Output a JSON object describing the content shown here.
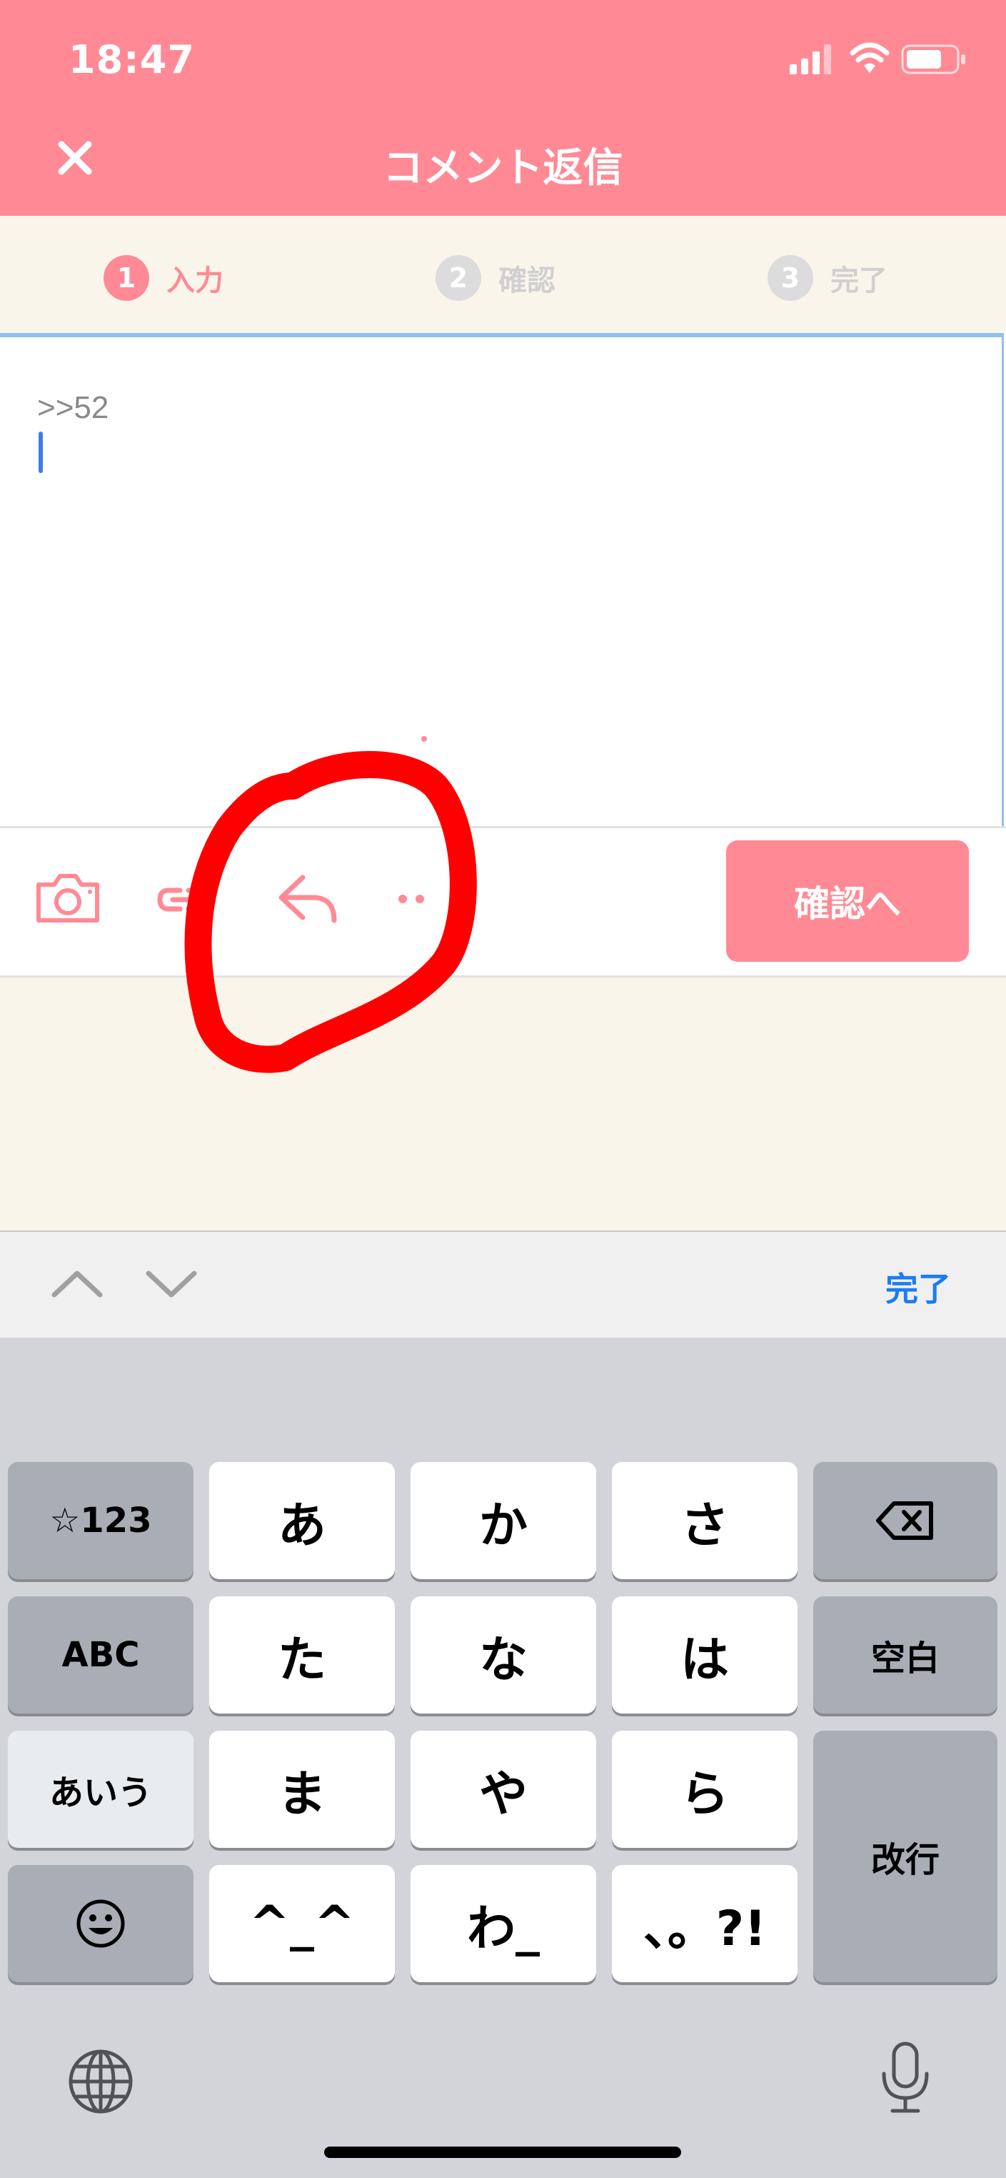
{
  "status_bar": {
    "time": "18:47"
  },
  "header": {
    "title": "コメント返信"
  },
  "steps": [
    {
      "number": "1",
      "label": "入力",
      "active": true
    },
    {
      "number": "2",
      "label": "確認",
      "active": false
    },
    {
      "number": "3",
      "label": "完了",
      "active": false
    }
  ],
  "editor": {
    "text": ">>52"
  },
  "toolbar": {
    "confirm_label": "確認へ"
  },
  "accessory": {
    "done_label": "完了"
  },
  "keyboard": {
    "row1": [
      "☆123",
      "あ",
      "か",
      "さ"
    ],
    "row2": [
      "ABC",
      "た",
      "な",
      "は",
      "空白"
    ],
    "row3": [
      "あいう",
      "ま",
      "や",
      "ら"
    ],
    "row4": [
      "^_^",
      "わ_",
      "、。?!"
    ],
    "return_label": "改行"
  },
  "colors": {
    "brand": "#ff8a95",
    "cream": "#faf5ea",
    "link_blue": "#1a7cf5",
    "annotation": "#ff0000"
  }
}
